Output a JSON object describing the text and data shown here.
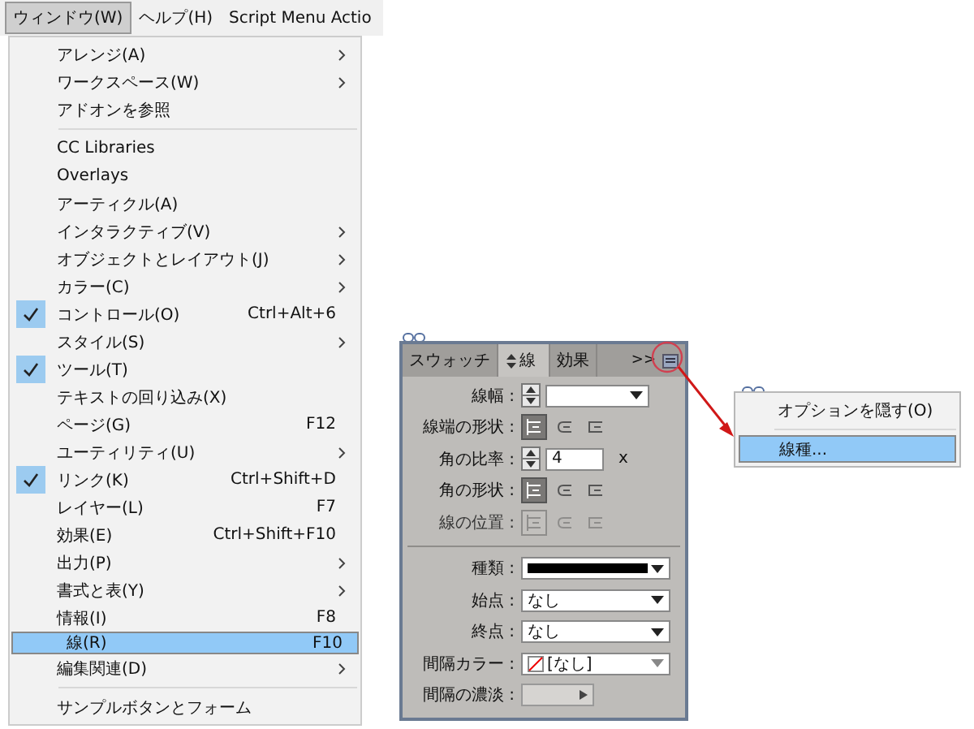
{
  "menu_bar": [
    {
      "label": "ウィンドウ(W)",
      "selected": true
    },
    {
      "label": "ヘルプ(H)",
      "selected": false
    },
    {
      "label": "Script Menu Actio",
      "selected": false
    }
  ],
  "window_menu": {
    "groups": [
      [
        {
          "label": "アレンジ(A)",
          "submenu": true,
          "checked": false,
          "selected": false
        },
        {
          "label": "ワークスペース(W)",
          "submenu": true,
          "checked": false,
          "selected": false
        },
        {
          "label": "アドオンを参照",
          "submenu": false,
          "checked": false,
          "selected": false
        }
      ],
      [
        {
          "label": "CC Libraries",
          "submenu": false,
          "checked": false,
          "selected": false
        },
        {
          "label": "Overlays",
          "submenu": false,
          "checked": false,
          "selected": false
        },
        {
          "label": "アーティクル(A)",
          "submenu": false,
          "checked": false,
          "selected": false
        },
        {
          "label": "インタラクティブ(V)",
          "submenu": true,
          "checked": false,
          "selected": false
        },
        {
          "label": "オブジェクトとレイアウト(J)",
          "submenu": true,
          "checked": false,
          "selected": false
        },
        {
          "label": "カラー(C)",
          "submenu": true,
          "checked": false,
          "selected": false
        },
        {
          "label": "コントロール(O)",
          "shortcut": "Ctrl+Alt+6",
          "submenu": false,
          "checked": true,
          "selected": false
        },
        {
          "label": "スタイル(S)",
          "submenu": true,
          "checked": false,
          "selected": false
        },
        {
          "label": "ツール(T)",
          "submenu": false,
          "checked": true,
          "selected": false
        },
        {
          "label": "テキストの回り込み(X)",
          "submenu": false,
          "checked": false,
          "selected": false
        },
        {
          "label": "ページ(G)",
          "shortcut": "F12",
          "submenu": false,
          "checked": false,
          "selected": false
        },
        {
          "label": "ユーティリティ(U)",
          "submenu": true,
          "checked": false,
          "selected": false
        },
        {
          "label": "リンク(K)",
          "shortcut": "Ctrl+Shift+D",
          "submenu": false,
          "checked": true,
          "selected": false
        },
        {
          "label": "レイヤー(L)",
          "shortcut": "F7",
          "submenu": false,
          "checked": false,
          "selected": false
        },
        {
          "label": "効果(E)",
          "shortcut": "Ctrl+Shift+F10",
          "submenu": false,
          "checked": false,
          "selected": false
        },
        {
          "label": "出力(P)",
          "submenu": true,
          "checked": false,
          "selected": false
        },
        {
          "label": "書式と表(Y)",
          "submenu": true,
          "checked": false,
          "selected": false
        },
        {
          "label": "情報(I)",
          "shortcut": "F8",
          "submenu": false,
          "checked": false,
          "selected": false
        },
        {
          "label": "線(R)",
          "shortcut": "F10",
          "submenu": false,
          "checked": false,
          "selected": true
        },
        {
          "label": "編集関連(D)",
          "submenu": true,
          "checked": false,
          "selected": false
        }
      ],
      [
        {
          "label": "サンプルボタンとフォーム",
          "submenu": false,
          "checked": false,
          "selected": false
        }
      ]
    ]
  },
  "stroke_panel": {
    "tabs": [
      {
        "label": "スウォッチ",
        "selected": false
      },
      {
        "label": "線",
        "selected": true
      },
      {
        "label": "効果",
        "selected": false
      }
    ],
    "more": ">>",
    "rows": [
      {
        "kind": "spin-select",
        "label": "線幅 :"
      },
      {
        "kind": "icons",
        "label": "線端の形状 :",
        "disabled": false,
        "options": [
          {
            "selected": true
          },
          {
            "selected": false
          },
          {
            "selected": false
          }
        ]
      },
      {
        "kind": "spin-input",
        "label": "角の比率 :",
        "value": "4",
        "unit": "x"
      },
      {
        "kind": "icons",
        "label": "角の形状 :",
        "disabled": false,
        "options": [
          {
            "selected": true
          },
          {
            "selected": false
          },
          {
            "selected": false
          }
        ]
      },
      {
        "kind": "icons",
        "label": "線の位置 :",
        "disabled": true,
        "options": [
          {
            "selected": true
          },
          {
            "selected": false
          },
          {
            "selected": false
          }
        ]
      },
      {
        "kind": "divider"
      },
      {
        "kind": "stroke-select",
        "label": "種類 :"
      },
      {
        "kind": "select",
        "label": "始点 :",
        "value": "なし"
      },
      {
        "kind": "select",
        "label": "終点 :",
        "value": "なし"
      },
      {
        "kind": "swatch-select",
        "label": "間隔カラー :",
        "value": "[なし]"
      },
      {
        "kind": "tint",
        "label": "間隔の濃淡 :"
      }
    ]
  },
  "panel_menu": {
    "items": [
      {
        "label": "オプションを隠す(O)",
        "selected": false
      },
      {
        "label": "線種...",
        "selected": true
      }
    ]
  }
}
